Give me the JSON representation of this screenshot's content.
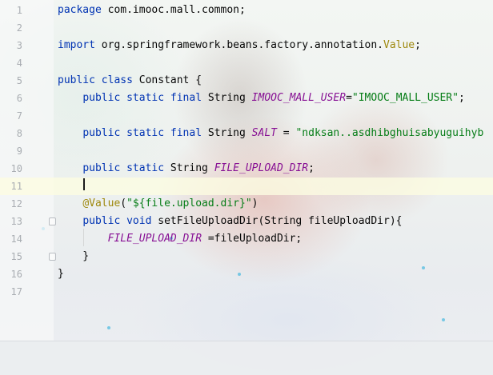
{
  "editor": {
    "lines": [
      {
        "n": "1",
        "tokens": [
          {
            "t": "package",
            "c": "kw"
          },
          {
            "t": " com.imooc.mall.common;",
            "c": "plain"
          }
        ]
      },
      {
        "n": "2",
        "tokens": []
      },
      {
        "n": "3",
        "tokens": [
          {
            "t": "import",
            "c": "kw"
          },
          {
            "t": " org.springframework.beans.factory.annotation.",
            "c": "plain"
          },
          {
            "t": "Value",
            "c": "ann"
          },
          {
            "t": ";",
            "c": "plain"
          }
        ]
      },
      {
        "n": "4",
        "tokens": []
      },
      {
        "n": "5",
        "tokens": [
          {
            "t": "public",
            "c": "kw"
          },
          {
            "t": " ",
            "c": "plain"
          },
          {
            "t": "class",
            "c": "kw"
          },
          {
            "t": " Constant {",
            "c": "plain"
          }
        ]
      },
      {
        "n": "6",
        "tokens": [
          {
            "t": "    ",
            "c": "plain"
          },
          {
            "t": "public",
            "c": "kw"
          },
          {
            "t": " ",
            "c": "plain"
          },
          {
            "t": "static",
            "c": "kw"
          },
          {
            "t": " ",
            "c": "plain"
          },
          {
            "t": "final",
            "c": "kw"
          },
          {
            "t": " String ",
            "c": "plain"
          },
          {
            "t": "IMOOC_MALL_USER",
            "c": "fld"
          },
          {
            "t": "=",
            "c": "plain"
          },
          {
            "t": "\"IMOOC_MALL_USER\"",
            "c": "str"
          },
          {
            "t": ";",
            "c": "plain"
          }
        ]
      },
      {
        "n": "7",
        "tokens": []
      },
      {
        "n": "8",
        "tokens": [
          {
            "t": "    ",
            "c": "plain"
          },
          {
            "t": "public",
            "c": "kw"
          },
          {
            "t": " ",
            "c": "plain"
          },
          {
            "t": "static",
            "c": "kw"
          },
          {
            "t": " ",
            "c": "plain"
          },
          {
            "t": "final",
            "c": "kw"
          },
          {
            "t": " String ",
            "c": "plain"
          },
          {
            "t": "SALT",
            "c": "fld"
          },
          {
            "t": " = ",
            "c": "plain"
          },
          {
            "t": "\"ndksan..asdhibghuisabyuguihyb",
            "c": "str"
          }
        ]
      },
      {
        "n": "9",
        "tokens": []
      },
      {
        "n": "10",
        "tokens": [
          {
            "t": "    ",
            "c": "plain"
          },
          {
            "t": "public",
            "c": "kw"
          },
          {
            "t": " ",
            "c": "plain"
          },
          {
            "t": "static",
            "c": "kw"
          },
          {
            "t": " String ",
            "c": "plain"
          },
          {
            "t": "FILE_UPLOAD_DIR",
            "c": "fld"
          },
          {
            "t": ";",
            "c": "plain"
          }
        ]
      },
      {
        "n": "11",
        "tokens": [],
        "current": true
      },
      {
        "n": "12",
        "tokens": [
          {
            "t": "    ",
            "c": "plain"
          },
          {
            "t": "@Value",
            "c": "ann"
          },
          {
            "t": "(",
            "c": "plain"
          },
          {
            "t": "\"${file.upload.dir}\"",
            "c": "str"
          },
          {
            "t": ")",
            "c": "plain"
          }
        ]
      },
      {
        "n": "13",
        "tokens": [
          {
            "t": "    ",
            "c": "plain"
          },
          {
            "t": "public",
            "c": "kw"
          },
          {
            "t": " ",
            "c": "plain"
          },
          {
            "t": "void",
            "c": "kw"
          },
          {
            "t": " setFileUploadDir(String fileUploadDir){",
            "c": "plain"
          }
        ]
      },
      {
        "n": "14",
        "tokens": [
          {
            "t": "        ",
            "c": "plain"
          },
          {
            "t": "FILE_UPLOAD_DIR",
            "c": "fld"
          },
          {
            "t": " =fileUploadDir;",
            "c": "plain"
          }
        ]
      },
      {
        "n": "15",
        "tokens": [
          {
            "t": "    }",
            "c": "plain"
          }
        ]
      },
      {
        "n": "16",
        "tokens": [
          {
            "t": "}",
            "c": "plain"
          }
        ]
      },
      {
        "n": "17",
        "tokens": []
      }
    ],
    "fold_markers": [
      {
        "line": "13",
        "kind": "open"
      },
      {
        "line": "15",
        "kind": "close"
      }
    ],
    "colors": {
      "keyword": "#0033b3",
      "annotation": "#9e880d",
      "string": "#067d17",
      "field": "#871094",
      "text": "#080808",
      "line_number": "#a9adb2",
      "current_line": "#fdfce1"
    }
  }
}
